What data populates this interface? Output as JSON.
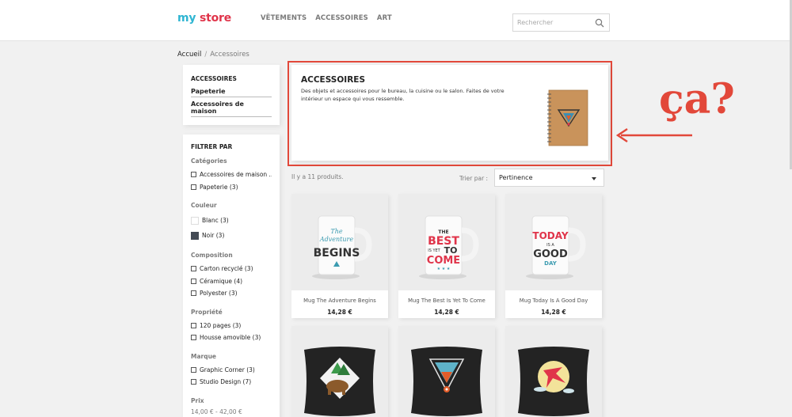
{
  "header": {
    "logo_my": "my",
    "logo_store": "store",
    "nav": [
      "VÊTEMENTS",
      "ACCESSOIRES",
      "ART"
    ],
    "search_placeholder": "Rechercher"
  },
  "breadcrumb": {
    "home": "Accueil",
    "current": "Accessoires"
  },
  "subcategories": {
    "title": "ACCESSOIRES",
    "items": [
      "Papeterie",
      "Accessoires de maison"
    ]
  },
  "filters": {
    "title": "FILTRER PAR",
    "categories": {
      "title": "Catégories",
      "options": [
        "Accessoires de maison ...",
        "Papeterie (3)"
      ]
    },
    "color": {
      "title": "Couleur",
      "options": [
        {
          "label": "Blanc (3)",
          "swatch": "#ffffff"
        },
        {
          "label": "Noir (3)",
          "swatch": "#434a54"
        }
      ]
    },
    "composition": {
      "title": "Composition",
      "options": [
        "Carton recyclé (3)",
        "Céramique (4)",
        "Polyester (3)"
      ]
    },
    "property": {
      "title": "Propriété",
      "options": [
        "120 pages (3)",
        "Housse amovible (3)"
      ]
    },
    "brand": {
      "title": "Marque",
      "options": [
        "Graphic Corner (3)",
        "Studio Design (7)"
      ]
    },
    "price": {
      "title": "Prix",
      "range": "14,00 € - 42,00 €"
    }
  },
  "category": {
    "title": "ACCESSOIRES",
    "description": "Des objets et accessoires pour le bureau, la cuisine ou le salon. Faites de votre intérieur un espace qui vous ressemble."
  },
  "annotation": {
    "text": "ça?",
    "color": "#e2483a"
  },
  "listing": {
    "count": "Il y a 11 produits.",
    "sort_label": "Trier par :",
    "sort_value": "Pertinence"
  },
  "products": [
    {
      "name": "Mug The Adventure Begins",
      "price": "14,28 €"
    },
    {
      "name": "Mug The Best Is Yet To Come",
      "price": "14,28 €"
    },
    {
      "name": "Mug Today Is A Good Day",
      "price": "14,28 €"
    }
  ],
  "mug_texts": {
    "adventure_1": "The",
    "adventure_2": "Adventure",
    "adventure_3": "BEGINS",
    "best_1": "THE",
    "best_2": "BEST",
    "best_3": "IS YET",
    "best_4": "TO",
    "best_5": "COME",
    "today_1": "TODAY",
    "today_2": "IS A",
    "today_3": "GOOD",
    "today_4": "DAY"
  },
  "colors": {
    "accent": "#2fb5d2",
    "brand_red": "#e0344a",
    "annotation_red": "#e2483a"
  }
}
